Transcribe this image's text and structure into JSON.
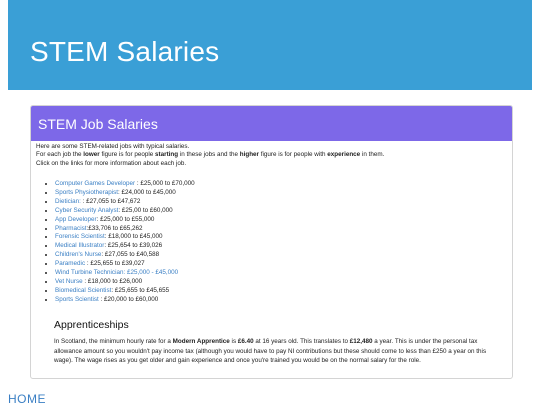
{
  "banner": {
    "title": "STEM Salaries"
  },
  "panel": {
    "heading": "STEM Job Salaries",
    "intro_line1": "Here are some STEM-related jobs with typical salaries.",
    "intro_line2": {
      "a": "For each job the ",
      "b": "lower",
      "c": " figure is for people ",
      "d": "starting",
      "e": " in these jobs and the ",
      "f": "higher",
      "g": " figure is for people with ",
      "h": "experience",
      "i": " in them."
    },
    "intro_line3": "Click on the links for more information about each job."
  },
  "jobs": [
    {
      "name": "Computer Games Developer",
      "salary": " : £25,000 to £70,000",
      "salary_link": false
    },
    {
      "name": "Sports Physiotherapist",
      "salary": ": £24,000 to £45,000",
      "salary_link": false
    },
    {
      "name": "Dietician:",
      "salary": " : £27,055 to £47,672",
      "salary_link": false
    },
    {
      "name": "Cyber Security Analyst",
      "salary": ": £25,00 to £60,000",
      "salary_link": false
    },
    {
      "name": "App Developer",
      "salary": ": £25,000 to £55,000",
      "salary_link": false
    },
    {
      "name": "Pharmacist",
      "salary": ":£33,706 to £65,262",
      "salary_link": false
    },
    {
      "name": "Forensic Scientist",
      "salary": ": £18,000 to £45,000",
      "salary_link": false
    },
    {
      "name": "Medical Illustrator",
      "salary": ": £25,654 to £39,026",
      "salary_link": false
    },
    {
      "name": "Children's Nurse",
      "salary": ": £27,055 to £40,588",
      "salary_link": false
    },
    {
      "name": "Paramedic",
      "salary": " : £25,655 to £39,027",
      "salary_link": false
    },
    {
      "name": "Wind Turbine Technician",
      "salary": ": £25,000 - £45,000",
      "salary_link": true
    },
    {
      "name": "Vet Nurse",
      "salary": " : £18,000 to £26,000",
      "salary_link": false
    },
    {
      "name": "Biomedical Scientist",
      "salary": ": £25,655 to £45,655",
      "salary_link": false
    },
    {
      "name": "Sports Scientist",
      "salary": " : £20,000 to £60,000",
      "salary_link": false
    }
  ],
  "apprenticeships": {
    "title": "Apprenticeships",
    "t1": "In Scotland, the minimum hourly rate for a ",
    "b1": "Modern Apprentice",
    "t2": " is ",
    "b2": "£6.40",
    "t3": " at 16 years old. This translates to ",
    "b3": "£12,480",
    "t4": " a year. This is under the personal tax allowance amount so you wouldn't pay income tax (although you would have to pay NI contributions but these should come to less than £250 a year on this wage). The wage rises as you get older and gain experience and once you're trained you would be on the normal salary for the role."
  },
  "footer": {
    "home_link": "HOME"
  },
  "colors": {
    "banner": "#3a9fd6",
    "panel_header": "#7d68e8",
    "link": "#3a7fc4"
  }
}
